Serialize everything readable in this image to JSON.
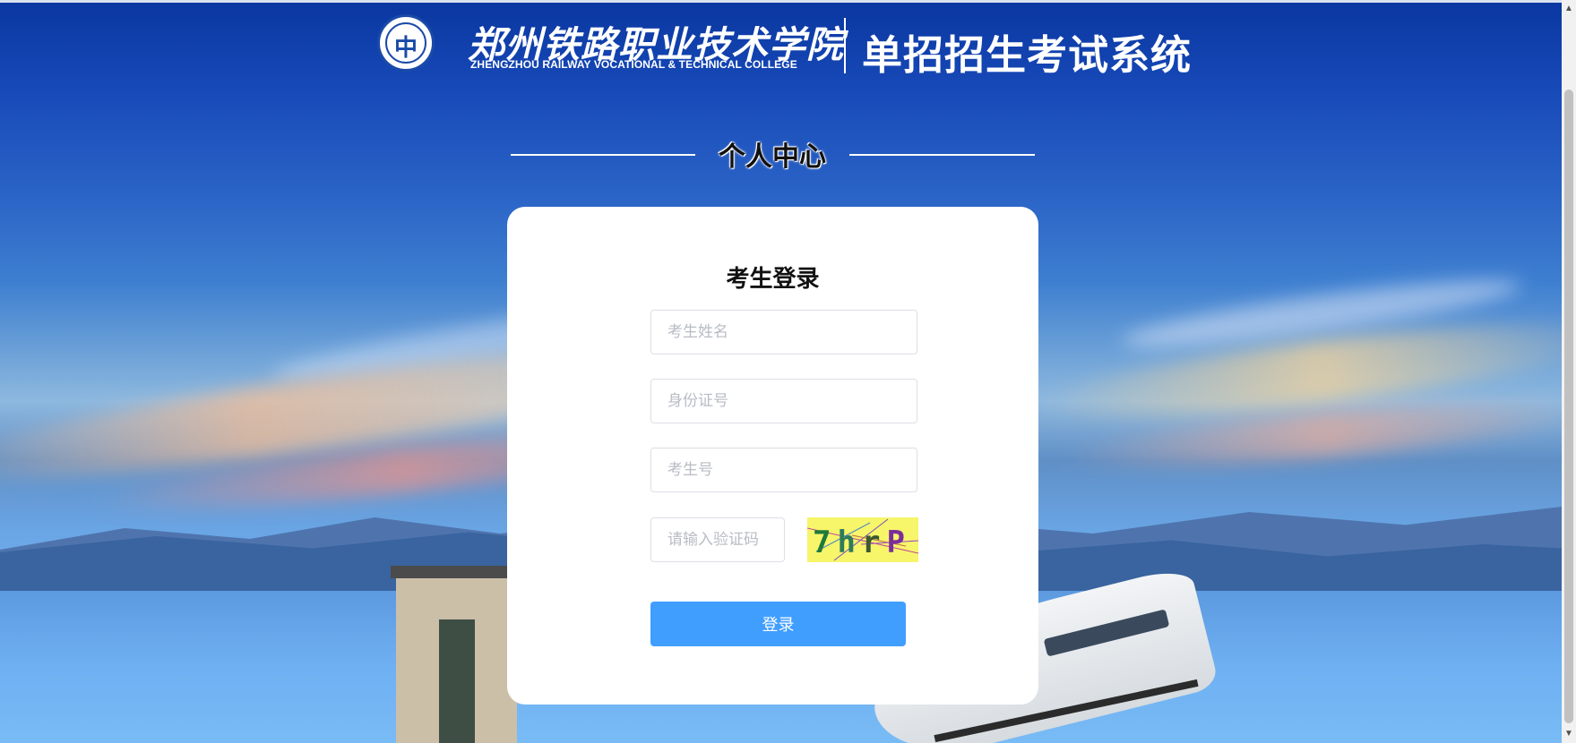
{
  "header": {
    "emblem_glyph": "中",
    "college_name_cn": "郑州铁路职业技术学院",
    "college_name_en": "ZHENGZHOU RAILWAY VOCATIONAL & TECHNICAL COLLEGE",
    "system_title": "单招招生考试系统"
  },
  "section": {
    "title": "个人中心"
  },
  "login": {
    "title": "考生登录",
    "name_placeholder": "考生姓名",
    "id_placeholder": "身份证号",
    "exam_no_placeholder": "考生号",
    "captcha_placeholder": "请输入验证码",
    "captcha_chars": [
      "7",
      "h",
      "r",
      "P"
    ],
    "captcha_colors": [
      "#1f7a3a",
      "#2e7d5a",
      "#3c5a30",
      "#7a2e9a"
    ],
    "submit_label": "登录"
  },
  "scrollbar": {
    "up_icon": "▲",
    "down_icon": "▼"
  },
  "colors": {
    "primary_button": "#409eff",
    "captcha_bg": "#f7f56a"
  }
}
